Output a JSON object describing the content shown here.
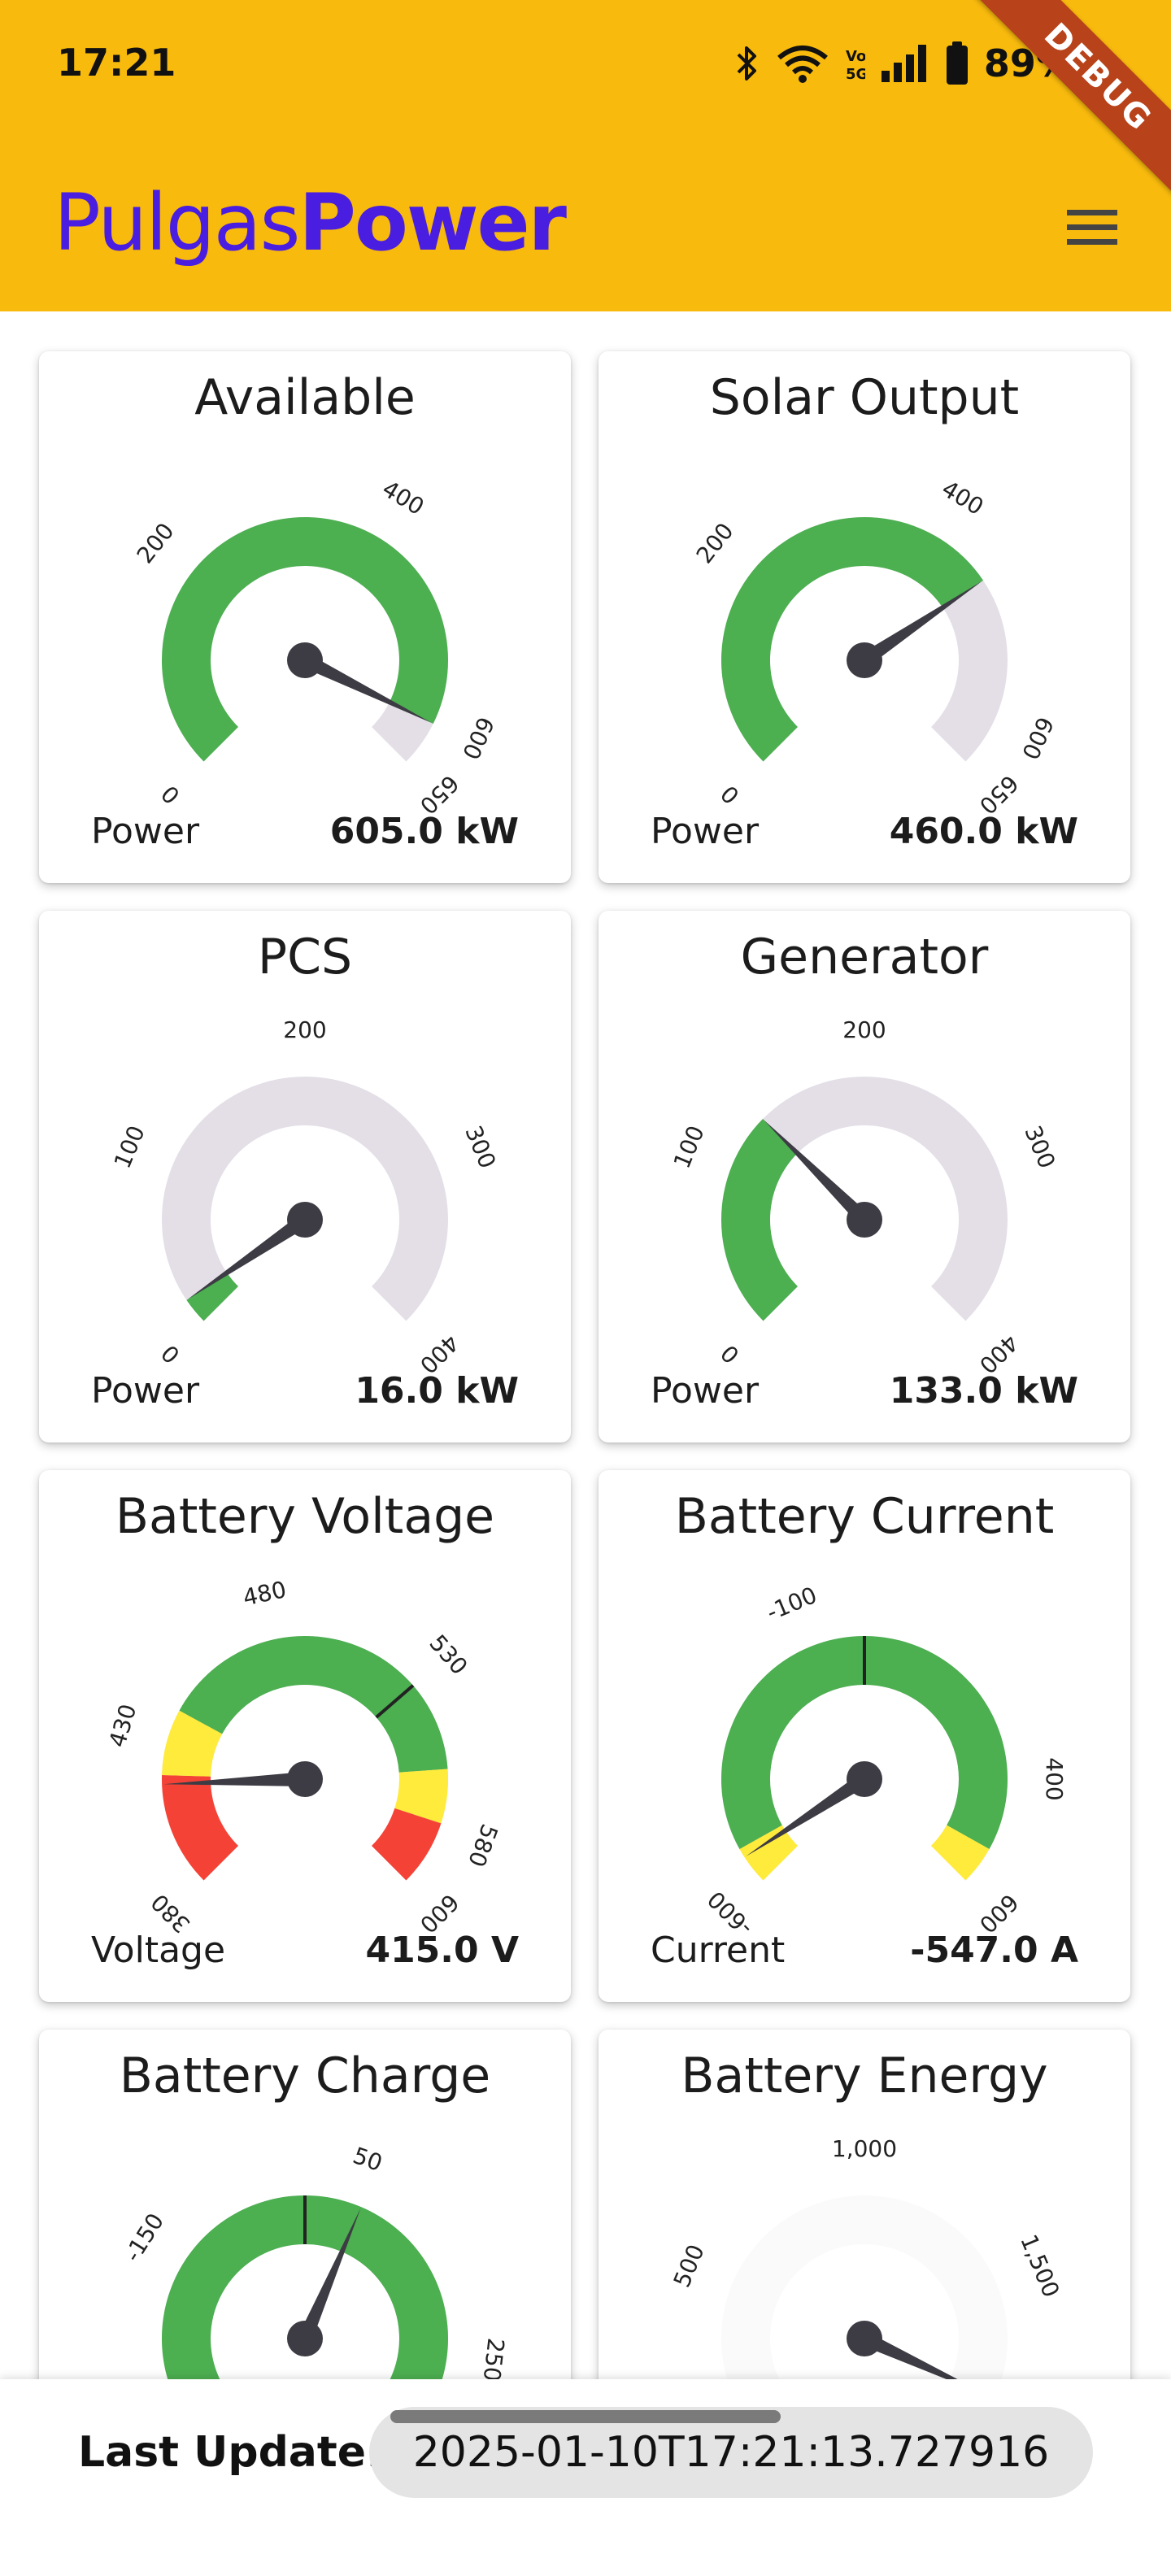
{
  "status_bar": {
    "time": "17:21",
    "battery_text": "89%",
    "icons": [
      "bluetooth-icon",
      "wifi-icon",
      "volte-icon",
      "signal-icon",
      "battery-icon"
    ]
  },
  "app_bar": {
    "brand_prefix": "Pulgas",
    "brand_suffix": "Power",
    "debug_banner": "DEBUG",
    "brand_color": "#4A1EE0",
    "bar_color": "#F8BA0D"
  },
  "gauges": [
    {
      "title": "Available",
      "label": "Power",
      "value_text": "605.0 kW",
      "min": 0,
      "max": 650,
      "value": 605,
      "ticks": [
        {
          "v": 0,
          "t": "0"
        },
        {
          "v": 200,
          "t": "200"
        },
        {
          "v": 400,
          "t": "400"
        },
        {
          "v": 600,
          "t": "600"
        },
        {
          "v": 650,
          "t": "650"
        }
      ],
      "ranges": [
        {
          "from": 0,
          "to": 605,
          "color": "#4CAF50"
        }
      ],
      "marks": []
    },
    {
      "title": "Solar Output",
      "label": "Power",
      "value_text": "460.0 kW",
      "min": 0,
      "max": 650,
      "value": 460,
      "ticks": [
        {
          "v": 0,
          "t": "0"
        },
        {
          "v": 200,
          "t": "200"
        },
        {
          "v": 400,
          "t": "400"
        },
        {
          "v": 600,
          "t": "600"
        },
        {
          "v": 650,
          "t": "650"
        }
      ],
      "ranges": [
        {
          "from": 0,
          "to": 460,
          "color": "#4CAF50"
        }
      ],
      "marks": []
    },
    {
      "title": "PCS",
      "label": "Power",
      "value_text": "16.0 kW",
      "min": 0,
      "max": 400,
      "value": 16,
      "ticks": [
        {
          "v": 0,
          "t": "0"
        },
        {
          "v": 100,
          "t": "100"
        },
        {
          "v": 200,
          "t": "200"
        },
        {
          "v": 300,
          "t": "300"
        },
        {
          "v": 400,
          "t": "400"
        }
      ],
      "ranges": [
        {
          "from": 0,
          "to": 16,
          "color": "#4CAF50"
        }
      ],
      "marks": []
    },
    {
      "title": "Generator",
      "label": "Power",
      "value_text": "133.0 kW",
      "min": 0,
      "max": 400,
      "value": 133,
      "ticks": [
        {
          "v": 0,
          "t": "0"
        },
        {
          "v": 100,
          "t": "100"
        },
        {
          "v": 200,
          "t": "200"
        },
        {
          "v": 300,
          "t": "300"
        },
        {
          "v": 400,
          "t": "400"
        }
      ],
      "ranges": [
        {
          "from": 0,
          "to": 133,
          "color": "#4CAF50"
        }
      ],
      "marks": []
    },
    {
      "title": "Battery Voltage",
      "label": "Voltage",
      "value_text": "415.0 V",
      "min": 380,
      "max": 600,
      "value": 415,
      "ticks": [
        {
          "v": 380,
          "t": "380"
        },
        {
          "v": 430,
          "t": "430"
        },
        {
          "v": 480,
          "t": "480"
        },
        {
          "v": 530,
          "t": "530"
        },
        {
          "v": 580,
          "t": "580"
        },
        {
          "v": 600,
          "t": "600"
        }
      ],
      "ranges": [
        {
          "from": 380,
          "to": 418,
          "color": "#F44336"
        },
        {
          "from": 418,
          "to": 440,
          "color": "#FFEB3B"
        },
        {
          "from": 440,
          "to": 560,
          "color": "#4CAF50"
        },
        {
          "from": 560,
          "to": 578,
          "color": "#FFEB3B"
        },
        {
          "from": 578,
          "to": 600,
          "color": "#F44336"
        }
      ],
      "marks": [
        530
      ]
    },
    {
      "title": "Battery Current",
      "label": "Current",
      "value_text": "-547.0 A",
      "min": -600,
      "max": 600,
      "value": -547,
      "ticks": [
        {
          "v": -600,
          "t": "-600"
        },
        {
          "v": -100,
          "t": "-100"
        },
        {
          "v": 400,
          "t": "400"
        },
        {
          "v": 600,
          "t": "600"
        }
      ],
      "ranges": [
        {
          "from": -600,
          "to": -530,
          "color": "#FFEB3B"
        },
        {
          "from": -530,
          "to": 530,
          "color": "#4CAF50"
        },
        {
          "from": 530,
          "to": 600,
          "color": "#FFEB3B"
        }
      ],
      "marks": [
        0
      ]
    },
    {
      "title": "Battery Charge",
      "label": "",
      "value_text": "",
      "min": -350,
      "max": 350,
      "value": 60,
      "ticks": [
        {
          "v": -150,
          "t": "-150"
        },
        {
          "v": 50,
          "t": "50"
        },
        {
          "v": 250,
          "t": "250"
        }
      ],
      "ranges": [
        {
          "from": -350,
          "to": -300,
          "color": "#FFEB3B"
        },
        {
          "from": -300,
          "to": 300,
          "color": "#4CAF50"
        },
        {
          "from": 300,
          "to": 350,
          "color": "#FFEB3B"
        }
      ],
      "marks": [
        0
      ]
    },
    {
      "title": "Battery Energy",
      "label": "",
      "value_text": "",
      "min": 0,
      "max": 2000,
      "value": 1850,
      "ticks": [
        {
          "v": 500,
          "t": "500"
        },
        {
          "v": 1000,
          "t": "1,000"
        },
        {
          "v": 1500,
          "t": "1,500"
        }
      ],
      "ranges": [],
      "marks": []
    }
  ],
  "footer": {
    "label": "Last Update:",
    "value": "2025-01-10T17:21:13.727916"
  }
}
